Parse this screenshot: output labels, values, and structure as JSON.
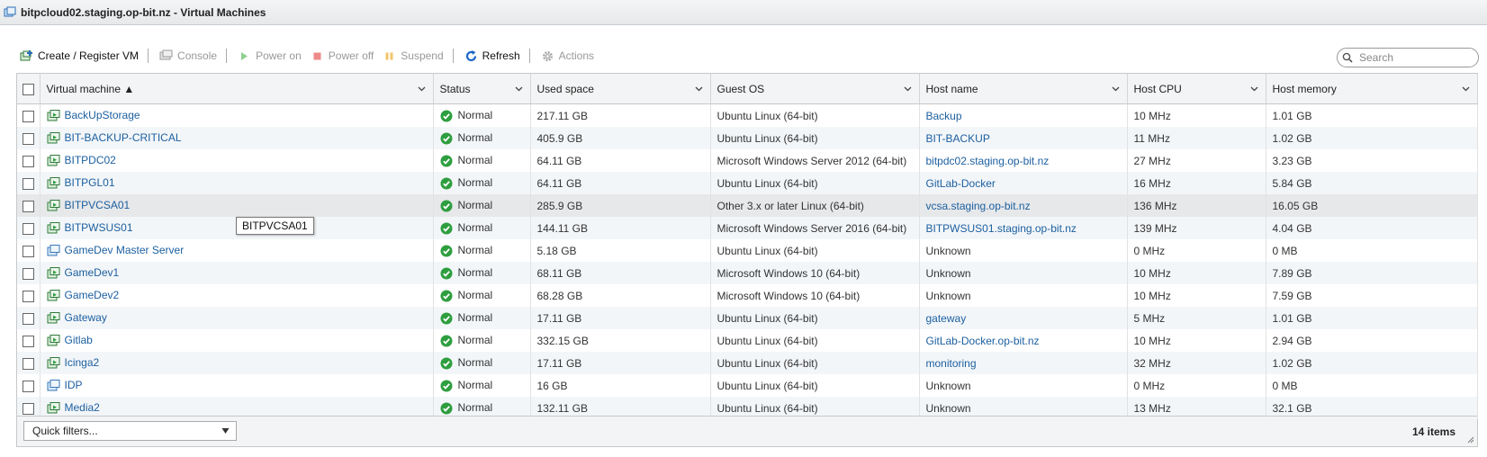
{
  "window": {
    "title": "bitpcloud02.staging.op-bit.nz - Virtual Machines"
  },
  "toolbar": {
    "create": "Create / Register VM",
    "console": "Console",
    "power_on": "Power on",
    "power_off": "Power off",
    "suspend": "Suspend",
    "refresh": "Refresh",
    "actions": "Actions"
  },
  "search": {
    "placeholder": "Search"
  },
  "columns": {
    "vm": "Virtual machine ▲",
    "status": "Status",
    "used": "Used space",
    "os": "Guest OS",
    "host": "Host name",
    "cpu": "Host CPU",
    "mem": "Host memory"
  },
  "rows": [
    {
      "name": "BackUpStorage",
      "status": "Normal",
      "used": "217.11 GB",
      "os": "Ubuntu Linux (64-bit)",
      "host": "Backup",
      "cpu": "10 MHz",
      "mem": "1.01 GB"
    },
    {
      "name": "BIT-BACKUP-CRITICAL",
      "status": "Normal",
      "used": "405.9 GB",
      "os": "Ubuntu Linux (64-bit)",
      "host": "BIT-BACKUP",
      "cpu": "11 MHz",
      "mem": "1.02 GB"
    },
    {
      "name": "BITPDC02",
      "status": "Normal",
      "used": "64.11 GB",
      "os": "Microsoft Windows Server 2012 (64-bit)",
      "host": "bitpdc02.staging.op-bit.nz",
      "cpu": "27 MHz",
      "mem": "3.23 GB"
    },
    {
      "name": "BITPGL01",
      "status": "Normal",
      "used": "64.11 GB",
      "os": "Ubuntu Linux (64-bit)",
      "host": "GitLab-Docker",
      "cpu": "16 MHz",
      "mem": "5.84 GB"
    },
    {
      "name": "BITPVCSA01",
      "status": "Normal",
      "used": "285.9 GB",
      "os": "Other 3.x or later Linux (64-bit)",
      "host": "vcsa.staging.op-bit.nz",
      "cpu": "136 MHz",
      "mem": "16.05 GB"
    },
    {
      "name": "BITPWSUS01",
      "status": "Normal",
      "used": "144.11 GB",
      "os": "Microsoft Windows Server 2016 (64-bit)",
      "host": "BITPWSUS01.staging.op-bit.nz",
      "cpu": "139 MHz",
      "mem": "4.04 GB"
    },
    {
      "name": "GameDev Master Server",
      "status": "Normal",
      "used": "5.18 GB",
      "os": "Ubuntu Linux (64-bit)",
      "host": "Unknown",
      "cpu": "0 MHz",
      "mem": "0 MB"
    },
    {
      "name": "GameDev1",
      "status": "Normal",
      "used": "68.11 GB",
      "os": "Microsoft Windows 10 (64-bit)",
      "host": "Unknown",
      "cpu": "10 MHz",
      "mem": "7.89 GB"
    },
    {
      "name": "GameDev2",
      "status": "Normal",
      "used": "68.28 GB",
      "os": "Microsoft Windows 10 (64-bit)",
      "host": "Unknown",
      "cpu": "10 MHz",
      "mem": "7.59 GB"
    },
    {
      "name": "Gateway",
      "status": "Normal",
      "used": "17.11 GB",
      "os": "Ubuntu Linux (64-bit)",
      "host": "gateway",
      "cpu": "5 MHz",
      "mem": "1.01 GB"
    },
    {
      "name": "Gitlab",
      "status": "Normal",
      "used": "332.15 GB",
      "os": "Ubuntu Linux (64-bit)",
      "host": "GitLab-Docker.op-bit.nz",
      "cpu": "10 MHz",
      "mem": "2.94 GB"
    },
    {
      "name": "Icinga2",
      "status": "Normal",
      "used": "17.11 GB",
      "os": "Ubuntu Linux (64-bit)",
      "host": "monitoring",
      "cpu": "32 MHz",
      "mem": "1.02 GB"
    },
    {
      "name": "IDP",
      "status": "Normal",
      "used": "16 GB",
      "os": "Ubuntu Linux (64-bit)",
      "host": "Unknown",
      "cpu": "0 MHz",
      "mem": "0 MB"
    },
    {
      "name": "Media2",
      "status": "Normal",
      "used": "132.11 GB",
      "os": "Ubuntu Linux (64-bit)",
      "host": "Unknown",
      "cpu": "13 MHz",
      "mem": "32.1 GB"
    }
  ],
  "footer": {
    "quick_filters": "Quick filters...",
    "items": "14 items"
  },
  "tooltip": {
    "text": "BITPVCSA01"
  },
  "colors": {
    "link": "#1b5f9f",
    "status_ok": "#2e9e3f",
    "header_bg": "#f3f4f5"
  }
}
